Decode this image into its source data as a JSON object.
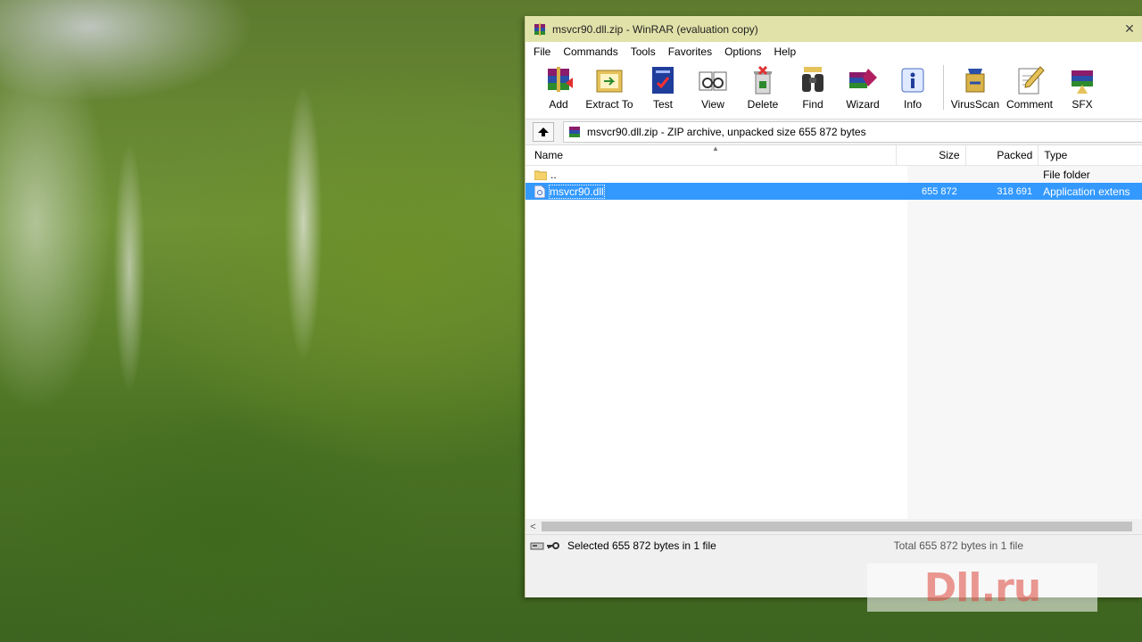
{
  "window": {
    "title": "msvcr90.dll.zip - WinRAR (evaluation copy)",
    "title_icon": "winrar-icon"
  },
  "menu": [
    "File",
    "Commands",
    "Tools",
    "Favorites",
    "Options",
    "Help"
  ],
  "toolbar": [
    {
      "label": "Add",
      "icon": "add-archive-icon"
    },
    {
      "label": "Extract To",
      "icon": "extract-to-icon"
    },
    {
      "label": "Test",
      "icon": "test-icon"
    },
    {
      "label": "View",
      "icon": "view-icon"
    },
    {
      "label": "Delete",
      "icon": "delete-icon"
    },
    {
      "label": "Find",
      "icon": "find-icon"
    },
    {
      "label": "Wizard",
      "icon": "wizard-icon"
    },
    {
      "label": "Info",
      "icon": "info-icon"
    },
    {
      "label": "VirusScan",
      "icon": "virusscan-icon"
    },
    {
      "label": "Comment",
      "icon": "comment-icon"
    },
    {
      "label": "SFX",
      "icon": "sfx-icon"
    }
  ],
  "address": {
    "text": "msvcr90.dll.zip - ZIP archive, unpacked size 655 872 bytes"
  },
  "columns": {
    "name": "Name",
    "size": "Size",
    "packed": "Packed",
    "type": "Type"
  },
  "files": [
    {
      "name": "..",
      "size": "",
      "packed": "",
      "type": "File folder",
      "icon": "folder-icon",
      "selected": false
    },
    {
      "name": "msvcr90.dll",
      "size": "655 872",
      "packed": "318 691",
      "type": "Application extens",
      "icon": "dll-file-icon",
      "selected": true
    }
  ],
  "status": {
    "selected": "Selected 655 872 bytes in 1 file",
    "total": "Total 655 872 bytes in 1 file"
  },
  "watermark": "Dll.ru",
  "colors": {
    "titlebar": "#e1e2a9",
    "selection": "#3399ff"
  }
}
